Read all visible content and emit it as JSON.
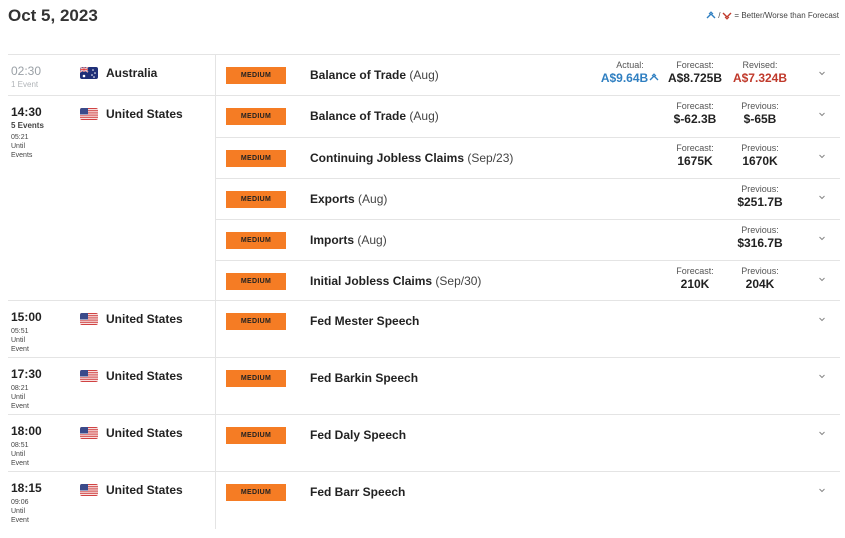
{
  "header": {
    "date": "Oct 5, 2023",
    "legend_text": "= Better/Worse than Forecast"
  },
  "colors": {
    "impact_medium": "#f57c24",
    "better": "#2f7fc1",
    "worse": "#c0392b"
  },
  "groups": [
    {
      "time": "02:30",
      "sub": "1 Event",
      "until": [],
      "past": true,
      "country": "Australia",
      "flag": "australia-flag-icon",
      "events": [
        {
          "impact": "MEDIUM",
          "name": "Balance of Trade",
          "period": "(Aug)",
          "stats": [
            {
              "label": "Actual:",
              "value": "A$9.64B",
              "tone": "better"
            },
            {
              "label": "Forecast:",
              "value": "A$8.725B",
              "tone": ""
            },
            {
              "label": "Revised:",
              "value": "A$7.324B",
              "tone": "worse"
            }
          ]
        }
      ]
    },
    {
      "time": "14:30",
      "sub": "5 Events",
      "until": [
        "05:21",
        "Until",
        "Events"
      ],
      "past": false,
      "country": "United States",
      "flag": "us-flag-icon",
      "events": [
        {
          "impact": "MEDIUM",
          "name": "Balance of Trade",
          "period": "(Aug)",
          "stats": [
            {
              "label": "Forecast:",
              "value": "$-62.3B",
              "tone": ""
            },
            {
              "label": "Previous:",
              "value": "$-65B",
              "tone": ""
            }
          ]
        },
        {
          "impact": "MEDIUM",
          "name": "Continuing Jobless Claims",
          "period": "(Sep/23)",
          "stats": [
            {
              "label": "Forecast:",
              "value": "1675K",
              "tone": ""
            },
            {
              "label": "Previous:",
              "value": "1670K",
              "tone": ""
            }
          ]
        },
        {
          "impact": "MEDIUM",
          "name": "Exports",
          "period": "(Aug)",
          "stats": [
            {
              "label": "Previous:",
              "value": "$251.7B",
              "tone": ""
            }
          ]
        },
        {
          "impact": "MEDIUM",
          "name": "Imports",
          "period": "(Aug)",
          "stats": [
            {
              "label": "Previous:",
              "value": "$316.7B",
              "tone": ""
            }
          ]
        },
        {
          "impact": "MEDIUM",
          "name": "Initial Jobless Claims",
          "period": "(Sep/30)",
          "stats": [
            {
              "label": "Forecast:",
              "value": "210K",
              "tone": ""
            },
            {
              "label": "Previous:",
              "value": "204K",
              "tone": ""
            }
          ]
        }
      ]
    },
    {
      "time": "15:00",
      "sub": "",
      "until": [
        "05:51",
        "Until",
        "Event"
      ],
      "past": false,
      "country": "United States",
      "flag": "us-flag-icon",
      "events": [
        {
          "impact": "MEDIUM",
          "name": "Fed Mester Speech",
          "period": "",
          "stats": []
        }
      ]
    },
    {
      "time": "17:30",
      "sub": "",
      "until": [
        "08:21",
        "Until",
        "Event"
      ],
      "past": false,
      "country": "United States",
      "flag": "us-flag-icon",
      "events": [
        {
          "impact": "MEDIUM",
          "name": "Fed Barkin Speech",
          "period": "",
          "stats": []
        }
      ]
    },
    {
      "time": "18:00",
      "sub": "",
      "until": [
        "08:51",
        "Until",
        "Event"
      ],
      "past": false,
      "country": "United States",
      "flag": "us-flag-icon",
      "events": [
        {
          "impact": "MEDIUM",
          "name": "Fed Daly Speech",
          "period": "",
          "stats": []
        }
      ]
    },
    {
      "time": "18:15",
      "sub": "",
      "until": [
        "09:06",
        "Until",
        "Event"
      ],
      "past": false,
      "country": "United States",
      "flag": "us-flag-icon",
      "events": [
        {
          "impact": "MEDIUM",
          "name": "Fed Barr Speech",
          "period": "",
          "stats": []
        }
      ]
    }
  ]
}
